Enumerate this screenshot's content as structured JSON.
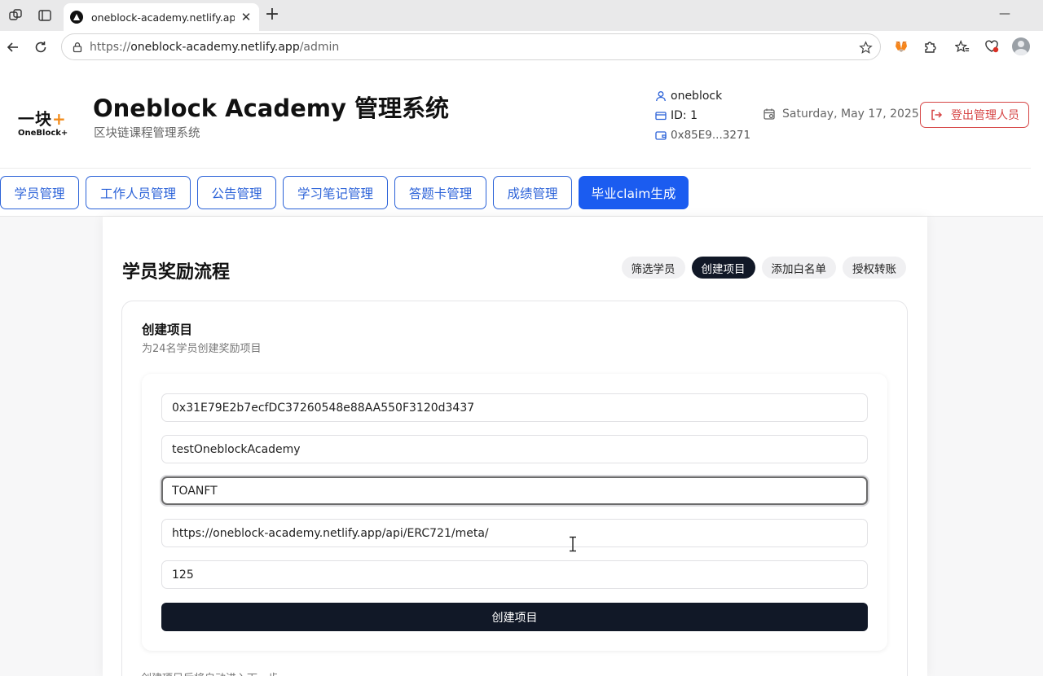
{
  "browser": {
    "tab_title": "oneblock-academy.netlify.app/ad",
    "address_scheme": "https://",
    "address_host": "oneblock-academy.netlify.app",
    "address_path": "/admin"
  },
  "header": {
    "logo_cn": "一块",
    "logo_plus": "+",
    "logo_en": "OneBlock+",
    "title": "Oneblock Academy 管理系统",
    "subtitle": "区块链课程管理系统",
    "username": "oneblock",
    "user_id": "ID: 1",
    "wallet": "0x85E9...3271",
    "date": "Saturday, May 17, 2025",
    "logout_label": "登出管理人员"
  },
  "nav": {
    "tabs": [
      {
        "label": "学员管理",
        "active": false
      },
      {
        "label": "工作人员管理",
        "active": false
      },
      {
        "label": "公告管理",
        "active": false
      },
      {
        "label": "学习笔记管理",
        "active": false
      },
      {
        "label": "答题卡管理",
        "active": false
      },
      {
        "label": "成绩管理",
        "active": false
      },
      {
        "label": "毕业claim生成",
        "active": true
      }
    ]
  },
  "flow": {
    "title": "学员奖励流程",
    "steps": [
      {
        "label": "筛选学员",
        "active": false
      },
      {
        "label": "创建项目",
        "active": true
      },
      {
        "label": "添加白名单",
        "active": false
      },
      {
        "label": "授权转账",
        "active": false
      }
    ]
  },
  "form": {
    "section_title": "创建项目",
    "section_desc": "为24名学员创建奖励项目",
    "fields": [
      {
        "value": "0x31E79E2b7ecfDC37260548e88AA550F3120d3437"
      },
      {
        "value": "testOneblockAcademy"
      },
      {
        "value": "TOANFT"
      },
      {
        "value": "https://oneblock-academy.netlify.app/api/ERC721/meta/"
      },
      {
        "value": "125"
      }
    ],
    "submit_label": "创建项目",
    "hint": "创建项目后将自动进入下一步"
  },
  "colors": {
    "primary": "#1b5cf0",
    "dark": "#111827",
    "danger": "#d64545",
    "logo_accent": "#f28c1c"
  }
}
